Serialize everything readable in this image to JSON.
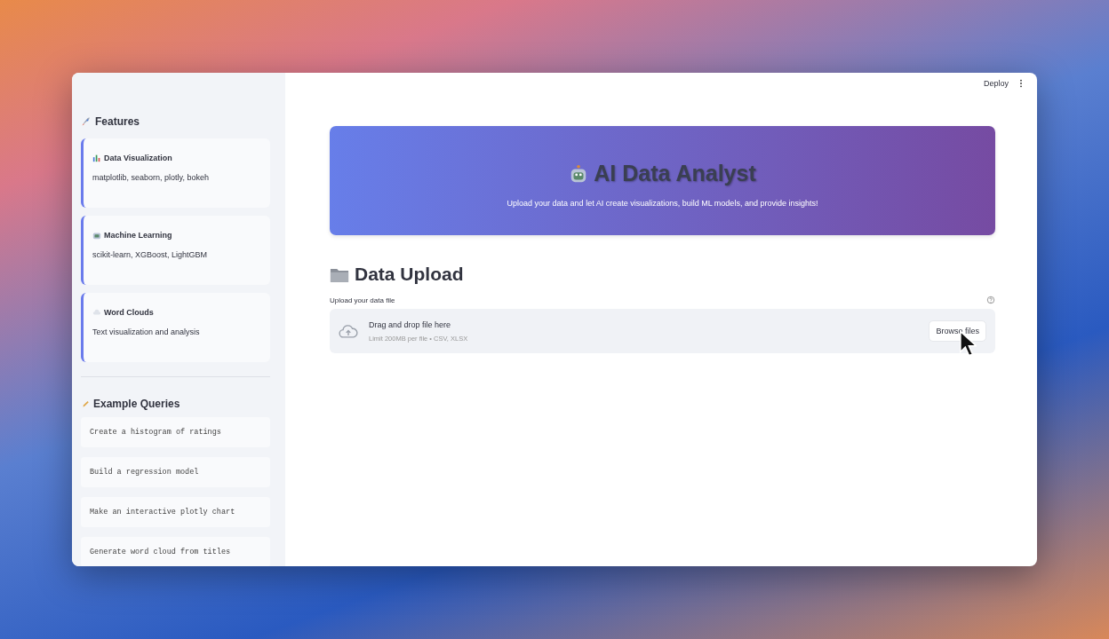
{
  "sidebar": {
    "features_title": "Features",
    "features": [
      {
        "title": "Data Visualization",
        "description": "matplotlib, seaborn, plotly, bokeh"
      },
      {
        "title": "Machine Learning",
        "description": "scikit-learn, XGBoost, LightGBM"
      },
      {
        "title": "Word Clouds",
        "description": "Text visualization and analysis"
      }
    ],
    "queries_title": "Example Queries",
    "queries": [
      "Create a histogram of ratings",
      "Build a regression model",
      "Make an interactive plotly chart",
      "Generate word cloud from titles"
    ]
  },
  "toolbar": {
    "deploy": "Deploy"
  },
  "hero": {
    "title": "AI Data Analyst",
    "subtitle": "Upload your data and let AI create visualizations, build ML models, and provide insights!"
  },
  "upload": {
    "heading": "Data Upload",
    "label": "Upload your data file",
    "drop_text": "Drag and drop file here",
    "limit_text": "Limit 200MB per file • CSV, XLSX",
    "button": "Browse files"
  }
}
